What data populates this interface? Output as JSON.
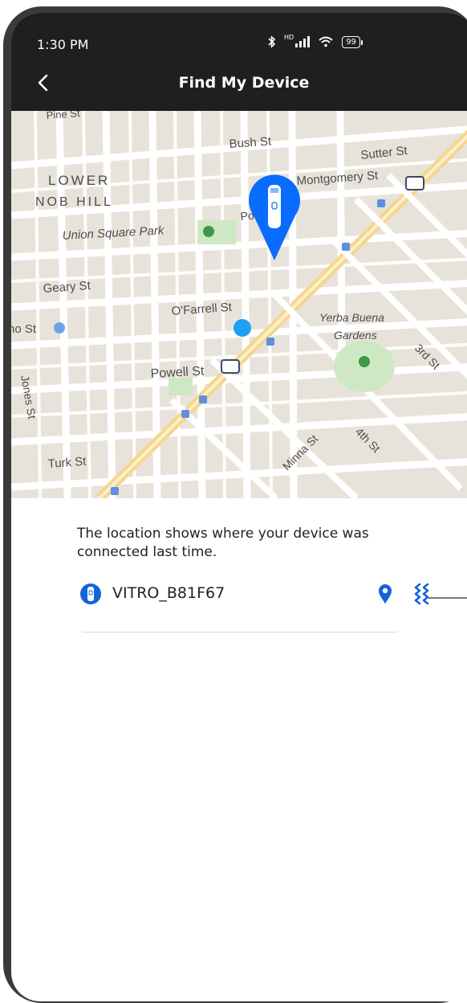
{
  "status": {
    "time": "1:30 PM",
    "battery": "99",
    "network_label": "HD"
  },
  "header": {
    "title": "Find My Device"
  },
  "map": {
    "streets": [
      "Bush St",
      "Sutter St",
      "Post",
      "Geary St",
      "O'Farrell St",
      "Powell St",
      "Turk St",
      "Jones St",
      "Minna St",
      "4th St",
      "3rd St",
      "Pine St",
      "no St"
    ],
    "places": [
      "LOWER",
      "NOB HILL",
      "Union Square Park",
      "Montgomery St",
      "Yerba Buena",
      "Gardens"
    ],
    "pin_color": "#0a6cff",
    "dot_color": "#1ea1f5"
  },
  "info": {
    "text": "The location shows where your device was connected last time."
  },
  "device": {
    "name": "VITRO_B81F67",
    "accent_color": "#1464d6"
  }
}
